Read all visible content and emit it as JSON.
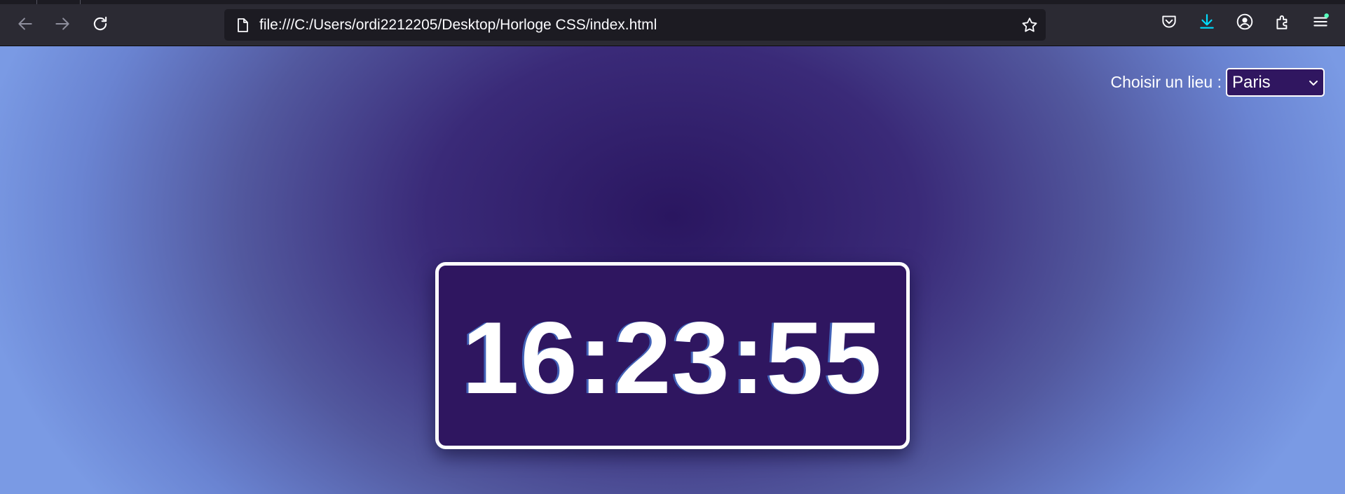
{
  "browser": {
    "url": "file:///C:/Users/ordi2212205/Desktop/Horloge CSS/index.html",
    "icons": {
      "back": "back-arrow-icon",
      "forward": "forward-arrow-icon",
      "reload": "reload-icon",
      "page": "page-icon",
      "bookmark": "star-icon",
      "pocket": "pocket-icon",
      "downloads": "download-icon",
      "account": "account-icon",
      "extensions": "extensions-icon",
      "menu": "hamburger-menu-icon"
    },
    "colors": {
      "chrome": "#2b2a33",
      "urlbar": "#1c1b22",
      "download_accent": "#00ddff",
      "notification_dot": "#54ffbd"
    }
  },
  "page": {
    "location_label": "Choisir un lieu :",
    "location_selected": "Paris",
    "clock_time": "16:23:55",
    "colors": {
      "clock_background": "#2f1660",
      "clock_border": "#ffffff",
      "select_background": "#301660",
      "gradient_center": "#2a1660",
      "gradient_edge": "#7a9ae4"
    }
  }
}
